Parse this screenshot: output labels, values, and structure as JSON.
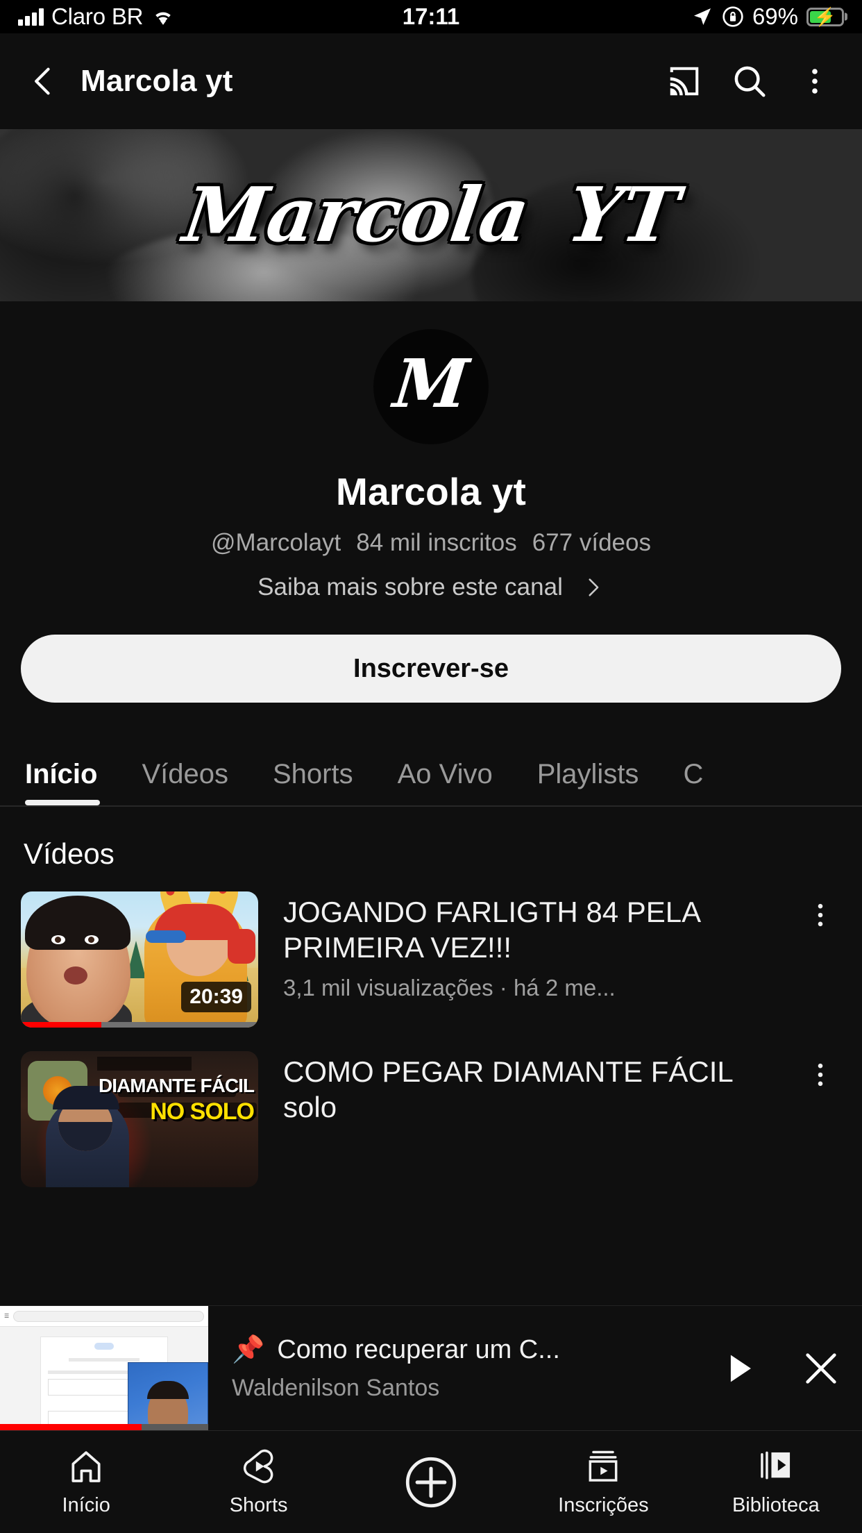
{
  "status_bar": {
    "carrier": "Claro BR",
    "time": "17:11",
    "battery_percent": "69%",
    "icons": [
      "signal-bars-icon",
      "wifi-icon",
      "location-arrow-icon",
      "rotation-lock-icon",
      "battery-charging-icon"
    ]
  },
  "app_bar": {
    "title": "Marcola yt",
    "icons": [
      "back-arrow-icon",
      "cast-icon",
      "search-icon",
      "overflow-menu-icon"
    ]
  },
  "banner": {
    "word1": "Marcola",
    "word2": "YT"
  },
  "channel": {
    "avatar_letter": "M",
    "name": "Marcola yt",
    "handle": "@Marcolayt",
    "subscribers": "84 mil inscritos",
    "video_count": "677 vídeos",
    "more_link": "Saiba mais sobre este canal",
    "subscribe_label": "Inscrever-se"
  },
  "tabs": [
    {
      "label": "Início",
      "active": true
    },
    {
      "label": "Vídeos",
      "active": false
    },
    {
      "label": "Shorts",
      "active": false
    },
    {
      "label": "Ao Vivo",
      "active": false
    },
    {
      "label": "Playlists",
      "active": false
    },
    {
      "label": "C",
      "active": false
    }
  ],
  "section": {
    "title": "Vídeos"
  },
  "videos": [
    {
      "title": "JOGANDO FARLIGTH 84 PELA PRIMEIRA VEZ!!!",
      "meta": "3,1 mil visualizações · há 2 me...",
      "duration": "20:39",
      "progress_percent": 34
    },
    {
      "title": "COMO PEGAR DIAMANTE FÁCIL solo",
      "meta": "",
      "duration": "",
      "overlay_line1": "DIAMANTE FÁCIL",
      "overlay_line2": "NO SOLO"
    }
  ],
  "miniplayer": {
    "pin": "📌",
    "title": "Como recuperar um C...",
    "author": "Waldenilson Santos",
    "play_icon": "play-icon",
    "close_icon": "close-icon"
  },
  "bottom_nav": [
    {
      "label": "Início",
      "icon": "home-icon"
    },
    {
      "label": "Shorts",
      "icon": "shorts-icon"
    },
    {
      "label": "",
      "icon": "create-plus-icon"
    },
    {
      "label": "Inscrições",
      "icon": "subscriptions-icon"
    },
    {
      "label": "Biblioteca",
      "icon": "library-icon"
    }
  ],
  "colors": {
    "background": "#0f0f0f",
    "accent_red": "#ff0000",
    "subscribe_bg": "#f1f1f1",
    "secondary_text": "#aaaaaa"
  }
}
